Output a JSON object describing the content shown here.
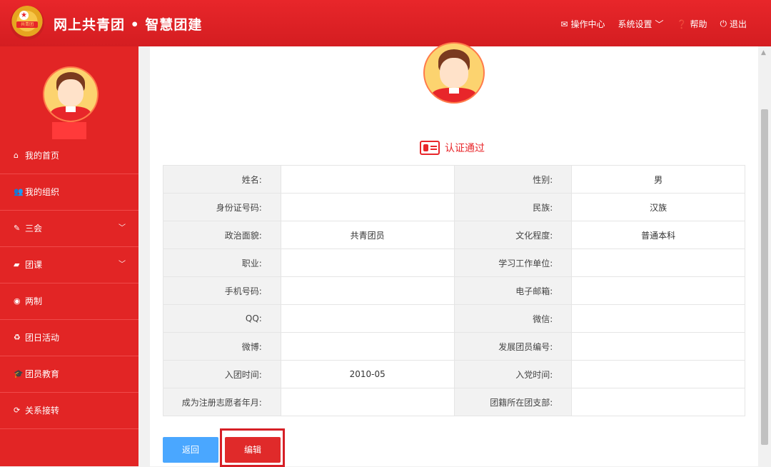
{
  "header": {
    "logo_text": "共青团",
    "title": "网上共青团 • 智慧团建",
    "nav": [
      {
        "icon": "envelope-icon",
        "label": "操作中心"
      },
      {
        "icon": "chevron-down-icon",
        "label": "系统设置"
      },
      {
        "icon": "question-icon",
        "label": "帮助"
      },
      {
        "icon": "power-icon",
        "label": "退出"
      }
    ]
  },
  "sidebar": {
    "items": [
      {
        "icon": "home-icon",
        "label": "我的首页"
      },
      {
        "icon": "users-icon",
        "label": "我的组织"
      },
      {
        "icon": "edit-icon",
        "label": "三会",
        "expandable": true
      },
      {
        "icon": "folder-icon",
        "label": "团课",
        "expandable": true
      },
      {
        "icon": "target-icon",
        "label": "两制"
      },
      {
        "icon": "recycle-icon",
        "label": "团日活动"
      },
      {
        "icon": "graduation-icon",
        "label": "团员教育"
      },
      {
        "icon": "refresh-icon",
        "label": "关系接转"
      }
    ]
  },
  "main": {
    "cert_status": "认证通过",
    "rows": [
      {
        "l1": "姓名:",
        "v1": "",
        "l2": "性别:",
        "v2": "男"
      },
      {
        "l1": "身份证号码:",
        "v1": "",
        "l2": "民族:",
        "v2": "汉族"
      },
      {
        "l1": "政治面貌:",
        "v1": "共青团员",
        "l2": "文化程度:",
        "v2": "普通本科"
      },
      {
        "l1": "职业:",
        "v1": "",
        "l2": "学习工作单位:",
        "v2": ""
      },
      {
        "l1": "手机号码:",
        "v1": "",
        "l2": "电子邮箱:",
        "v2": ""
      },
      {
        "l1": "QQ:",
        "v1": "",
        "l2": "微信:",
        "v2": ""
      },
      {
        "l1": "微博:",
        "v1": "",
        "l2": "发展团员编号:",
        "v2": ""
      },
      {
        "l1": "入团时间:",
        "v1": "2010-05",
        "l2": "入党时间:",
        "v2": ""
      },
      {
        "l1": "成为注册志愿者年月:",
        "v1": "",
        "l2": "团籍所在团支部:",
        "v2": ""
      }
    ],
    "back_label": "返回",
    "edit_label": "编辑"
  },
  "colors": {
    "primary": "#e22525",
    "back_button": "#4aa7ff",
    "edit_button": "#e02a2a"
  }
}
